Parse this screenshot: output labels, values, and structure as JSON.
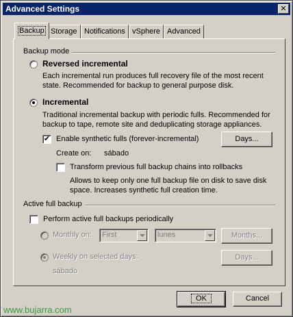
{
  "window": {
    "title": "Advanced Settings",
    "close_symbol": "✕"
  },
  "tabs": [
    {
      "label": "Backup",
      "active": true
    },
    {
      "label": "Storage"
    },
    {
      "label": "Notifications"
    },
    {
      "label": "vSphere"
    },
    {
      "label": "Advanced"
    }
  ],
  "backup_mode": {
    "group_label": "Backup mode",
    "reversed": {
      "label": "Reversed incremental",
      "description": "Each incremental run produces full recovery file of the most recent state. Recommended for backup to general purpose disk.",
      "selected": false
    },
    "incremental": {
      "label": "Incremental",
      "description": "Traditional incremental backup with periodic fulls. Recommended for backup to tape, remote site and deduplicating storage appliances.",
      "selected": true
    },
    "synthetic": {
      "label": "Enable synthetic fulls (forever-incremental)",
      "checked": true,
      "check_mark": "✔",
      "days_button": "Days...",
      "create_on_label": "Create on:",
      "create_on_value": "sábado"
    },
    "transform": {
      "label": "Transform previous full backup chains into rollbacks",
      "checked": false,
      "description": "Allows to keep only one full backup file on disk to save disk space. Increases synthetic full creation time."
    }
  },
  "active_full": {
    "group_label": "Active full backup",
    "perform": {
      "label": "Perform active full backups periodically",
      "checked": false
    },
    "monthly": {
      "label": "Monthly on:",
      "week_value": "First",
      "day_value": "lunes",
      "months_button": "Months..."
    },
    "weekly": {
      "label": "Weekly on selected days:",
      "days_button": "Days...",
      "value": "sábado"
    }
  },
  "footer": {
    "ok_label": "OK",
    "cancel_label": "Cancel"
  },
  "watermark": "www.bujarra.com"
}
